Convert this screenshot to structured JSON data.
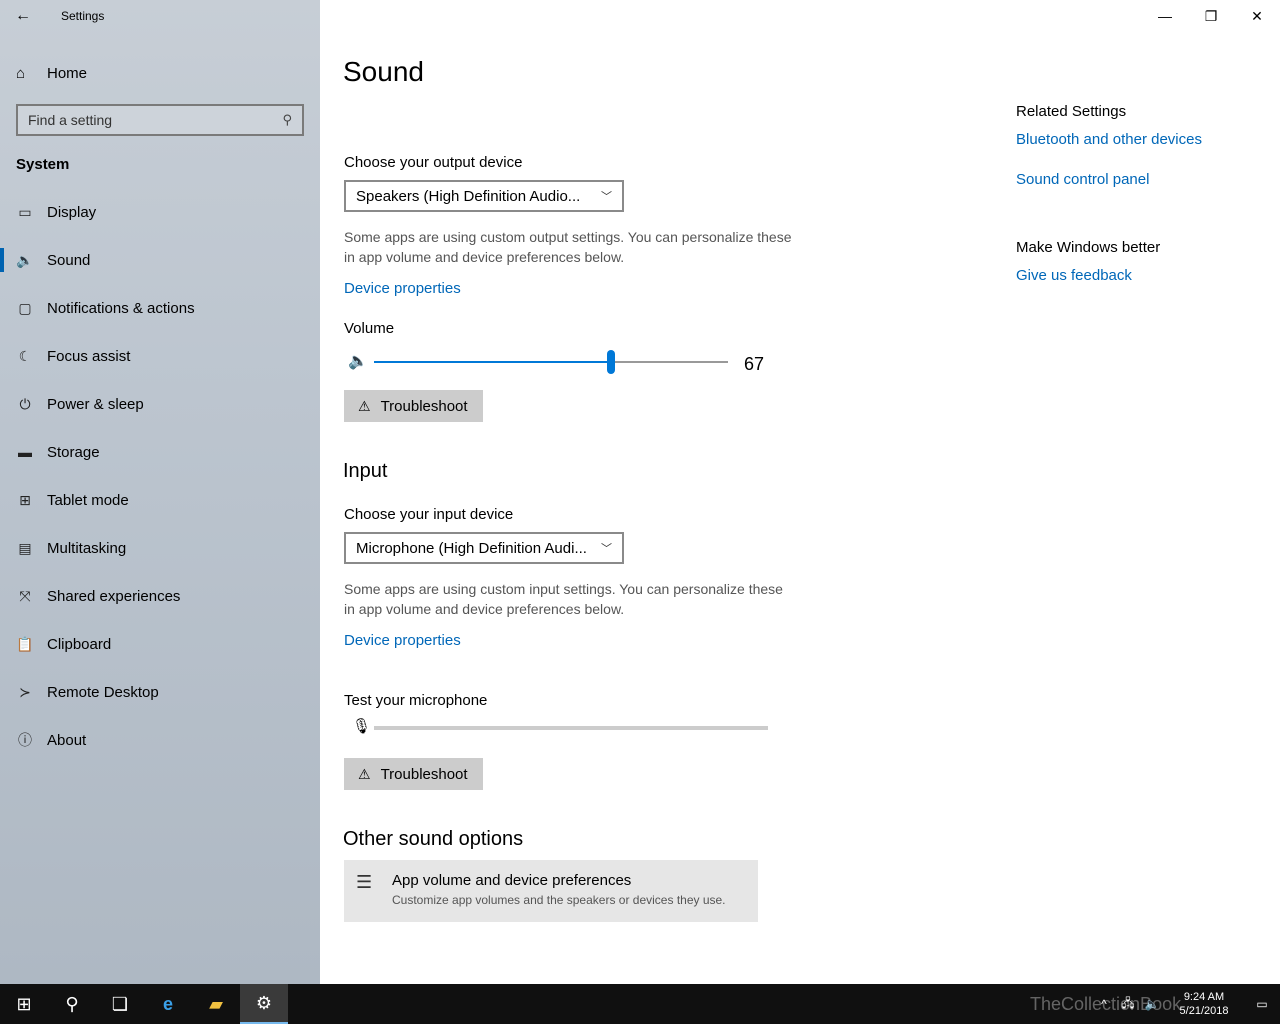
{
  "app": {
    "title": "Settings"
  },
  "sidebar": {
    "home_label": "Home",
    "search_placeholder": "Find a setting",
    "section": "System",
    "items": [
      {
        "label": "Display",
        "icon": "display-icon",
        "glyph": "▭"
      },
      {
        "label": "Sound",
        "icon": "speaker-icon",
        "glyph": "🔈",
        "active": true
      },
      {
        "label": "Notifications & actions",
        "icon": "notification-icon",
        "glyph": "▢"
      },
      {
        "label": "Focus assist",
        "icon": "moon-icon",
        "glyph": "☾"
      },
      {
        "label": "Power & sleep",
        "icon": "power-icon",
        "glyph": "⏻"
      },
      {
        "label": "Storage",
        "icon": "storage-icon",
        "glyph": "▬"
      },
      {
        "label": "Tablet mode",
        "icon": "tablet-icon",
        "glyph": "⊞"
      },
      {
        "label": "Multitasking",
        "icon": "multitasking-icon",
        "glyph": "▤"
      },
      {
        "label": "Shared experiences",
        "icon": "shared-icon",
        "glyph": "⤧"
      },
      {
        "label": "Clipboard",
        "icon": "clipboard-icon",
        "glyph": "📋"
      },
      {
        "label": "Remote Desktop",
        "icon": "remote-desktop-icon",
        "glyph": "≻"
      },
      {
        "label": "About",
        "icon": "info-icon",
        "glyph": "ⓘ"
      }
    ]
  },
  "main": {
    "title": "Sound",
    "output": {
      "label": "Choose your output device",
      "device": "Speakers (High Definition Audio...",
      "desc": "Some apps are using custom output settings. You can personalize these in app volume and device preferences below.",
      "device_properties": "Device properties",
      "volume_label": "Volume",
      "volume_value": "67",
      "troubleshoot": "Troubleshoot"
    },
    "input": {
      "heading": "Input",
      "label": "Choose your input device",
      "device": "Microphone (High Definition Audi...",
      "desc": "Some apps are using custom input settings. You can personalize these in app volume and device preferences below.",
      "device_properties": "Device properties",
      "test_label": "Test your microphone",
      "troubleshoot": "Troubleshoot"
    },
    "other": {
      "heading": "Other sound options",
      "card_title": "App volume and device preferences",
      "card_desc": "Customize app volumes and the speakers or devices they use."
    }
  },
  "related": {
    "heading": "Related Settings",
    "links": [
      "Bluetooth and other devices",
      "Sound control panel"
    ],
    "better_heading": "Make Windows better",
    "feedback": "Give us feedback"
  },
  "taskbar": {
    "time": "9:24 AM",
    "date": "5/21/2018",
    "watermark": "TheCollectionBook"
  },
  "colors": {
    "accent": "#0078d7",
    "link": "#0067b8",
    "taskbar": "#101010"
  }
}
